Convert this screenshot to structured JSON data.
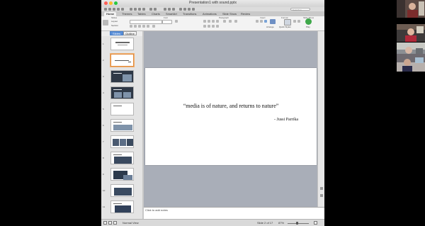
{
  "window": {
    "title": "Presentation1 with sound.pptx"
  },
  "toolbar": {
    "search_placeholder": "Search in Presentation"
  },
  "ribbon": {
    "tabs": [
      "Home",
      "Themes",
      "Tables",
      "Charts",
      "SmartArt",
      "Transitions",
      "Animations",
      "Slide Show",
      "Review"
    ],
    "groups": [
      "Slides",
      "Font",
      "Paragraph",
      "Insert",
      "Format",
      "Slide Show"
    ],
    "layout_label": "Layout",
    "section_label": "Section",
    "arrange_label": "Arrange",
    "quick_styles_label": "Quick Styles",
    "play_label": "Play"
  },
  "side_panel": {
    "tabs": [
      "Slides",
      "Outline"
    ],
    "slide_numbers": [
      "1",
      "2",
      "3",
      "4",
      "5",
      "6",
      "7",
      "8",
      "9",
      "10",
      "11"
    ]
  },
  "slide": {
    "quote": "“media is of  nature, and returns to nature”",
    "attribution": "- Jussi Parrika"
  },
  "notes": {
    "placeholder": "Click to add notes"
  },
  "status_bar": {
    "view_label": "Normal View",
    "slide_counter": "Slide 2 of 17",
    "zoom": "87%",
    "zoom_level_fraction": 0.45
  },
  "colors": {
    "selection_accent": "#e08a3c",
    "active_tab_blue": "#5a8fd8",
    "workspace_grey": "#a9aeb8"
  }
}
